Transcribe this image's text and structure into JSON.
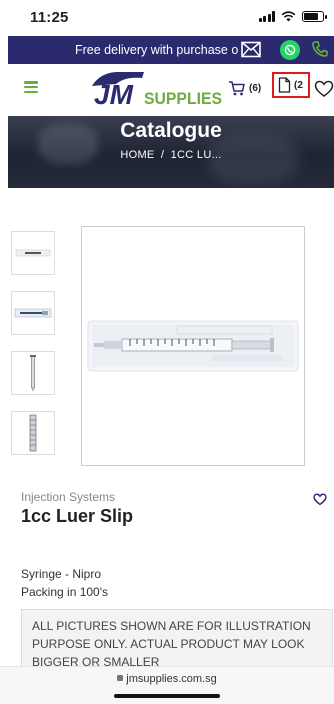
{
  "status_bar": {
    "time": "11:25"
  },
  "promo": {
    "text": "Free delivery with purchase o"
  },
  "header": {
    "logo_text_left": "JM",
    "logo_text_right": "SUPPLIES",
    "cart_count": "(6)",
    "quote_count": "(2"
  },
  "banner": {
    "title": "Catalogue",
    "breadcrumb_home": "HOME",
    "breadcrumb_sep": "/",
    "breadcrumb_current": "1CC LU..."
  },
  "product": {
    "category": "Injection Systems",
    "title": "1cc Luer Slip",
    "description_line1": "Syringe - Nipro",
    "description_line2": "Packing in 100's",
    "disclaimer": "ALL PICTURES SHOWN ARE FOR ILLUSTRATION PURPOSE ONLY. ACTUAL PRODUCT MAY LOOK BIGGER OR SMALLER"
  },
  "browser": {
    "url": "jmsupplies.com.sg"
  },
  "colors": {
    "brand_navy": "#2b2a6e",
    "brand_green": "#6cae3e",
    "whatsapp_green": "#25d366",
    "highlight_red": "#e01b1b"
  },
  "icons": [
    "signal-icon",
    "wifi-icon",
    "battery-icon",
    "mail-icon",
    "whatsapp-icon",
    "phone-icon",
    "menu-icon",
    "cart-icon",
    "document-icon",
    "heart-icon"
  ]
}
